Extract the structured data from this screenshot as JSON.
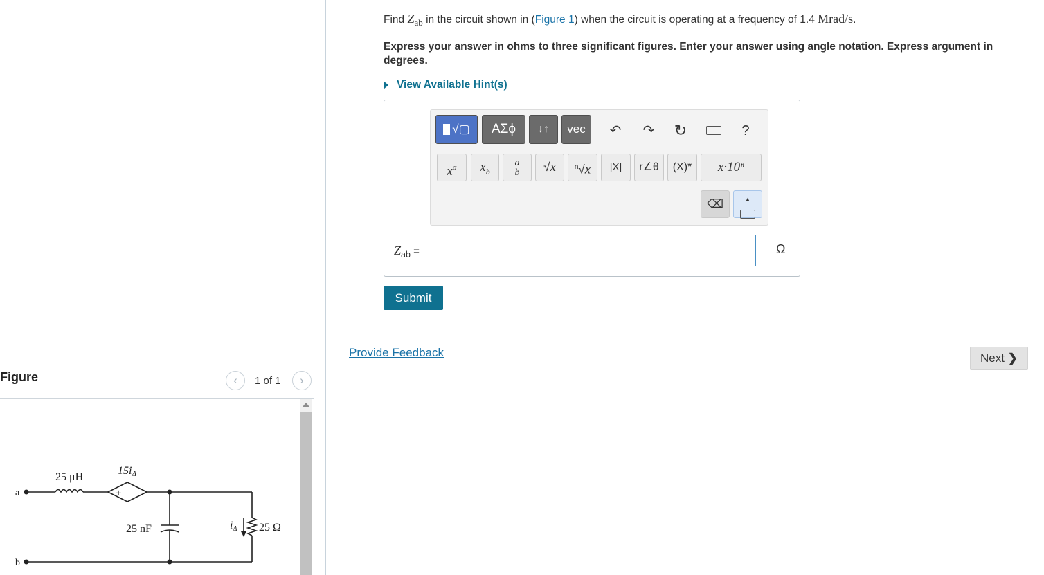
{
  "question": {
    "find_prefix": "Find ",
    "var_main": "Z",
    "var_sub": "ab",
    "text_mid": " in the circuit shown in (",
    "figure_link": "Figure 1",
    "text_after": ") when the circuit is operating at a frequency of 1.4 ",
    "freq_unit": "Mrad/s",
    "period": ".",
    "instructions": "Express your answer in ohms to three significant figures. Enter your answer using angle notation. Express argument in degrees.",
    "hint_label": "View Available Hint(s)"
  },
  "toolbar": {
    "row1": [
      "ΑΣϕ",
      "↓↑",
      "vec",
      "?"
    ],
    "row2_labels": {
      "abs": "|X|",
      "polar": "r∠θ",
      "conj": "(X)*",
      "sci": "x·10ⁿ"
    }
  },
  "answer": {
    "label_main": "Z",
    "label_sub": "ab",
    "equals": " =",
    "value": "",
    "unit": "Ω"
  },
  "buttons": {
    "submit": "Submit",
    "feedback": "Provide Feedback",
    "next": "Next"
  },
  "figure": {
    "title": "Figure",
    "counter": "1 of 1",
    "labels": {
      "node_a": "a",
      "node_b": "b",
      "inductor": "25 μH",
      "dependent_source": "15i",
      "dep_sub": "Δ",
      "capacitor": "25 nF",
      "current": "i",
      "current_sub": "Δ",
      "resistor": "25 Ω",
      "plus": "+"
    }
  },
  "colors": {
    "accent": "#0f7190",
    "link": "#1a73a8",
    "toolbar_dark": "#6b6b6b",
    "toolbar_active": "#4d73c6"
  }
}
